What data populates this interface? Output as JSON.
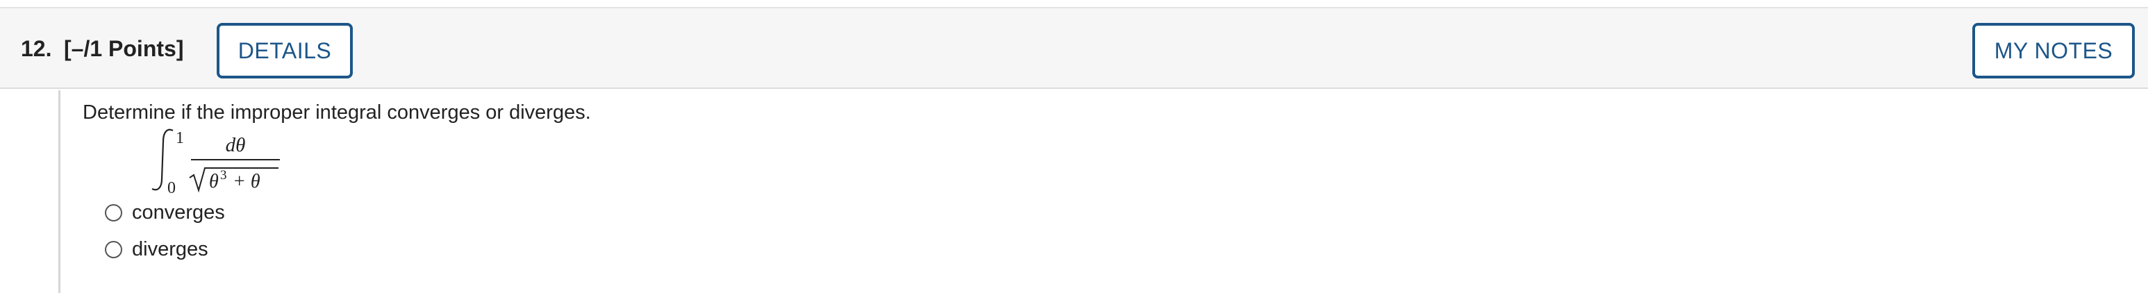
{
  "question": {
    "number": "12.",
    "points": "[–/1 Points]",
    "details_label": "DETAILS",
    "notes_label": "MY NOTES",
    "prompt": "Determine if the improper integral converges or diverges.",
    "integral": {
      "lower_limit": "0",
      "upper_limit": "1",
      "numerator": "dθ",
      "denominator_base": "θ",
      "denominator_exponent": "3",
      "denominator_rest": "+ θ"
    },
    "choices": [
      {
        "label": "converges",
        "selected": false
      },
      {
        "label": "diverges",
        "selected": false
      }
    ]
  }
}
